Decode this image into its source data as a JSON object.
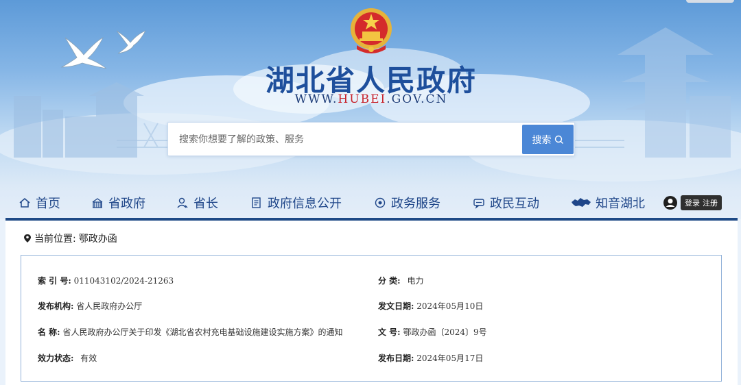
{
  "header": {
    "site_title": "湖北省人民政府",
    "url_prefix": "WWW.",
    "url_highlight": "HUBEI",
    "url_suffix": ".GOV.CN"
  },
  "search": {
    "placeholder": "搜索你想要了解的政策、服务",
    "button_label": "搜索"
  },
  "nav": {
    "items": [
      {
        "label": "首页",
        "icon": "home-icon"
      },
      {
        "label": "省政府",
        "icon": "building-icon"
      },
      {
        "label": "省长",
        "icon": "person-icon"
      },
      {
        "label": "政府信息公开",
        "icon": "document-icon"
      },
      {
        "label": "政务服务",
        "icon": "service-icon"
      },
      {
        "label": "政民互动",
        "icon": "chat-icon"
      },
      {
        "label": "知音湖北",
        "icon": "hubei-map-icon"
      }
    ],
    "login": "登录",
    "register": "注册"
  },
  "breadcrumb": {
    "prefix": "当前位置:",
    "current": "鄂政办函"
  },
  "doc_info": {
    "index_label": "索 引 号:",
    "index_value": "011043102/2024-21263",
    "category_label": "分 类:",
    "category_value": "电力",
    "publisher_label": "发布机构:",
    "publisher_value": "省人民政府办公厅",
    "issue_date_label": "发文日期:",
    "issue_date_value": "2024年05月10日",
    "name_label": "名 称:",
    "name_value": "省人民政府办公厅关于印发《湖北省农村充电基础设施建设实施方案》的通知",
    "doc_no_label": "文 号:",
    "doc_no_value": "鄂政办函〔2024〕9号",
    "status_label": "效力状态:",
    "status_value": "有效",
    "publish_date_label": "发布日期:",
    "publish_date_value": "2024年05月17日"
  },
  "colors": {
    "title_blue": "#1e4f9c",
    "nav_text": "#1f4689",
    "nav_underline": "#1e4a86",
    "search_button": "#4b87d6",
    "url_red": "#c8232c"
  }
}
